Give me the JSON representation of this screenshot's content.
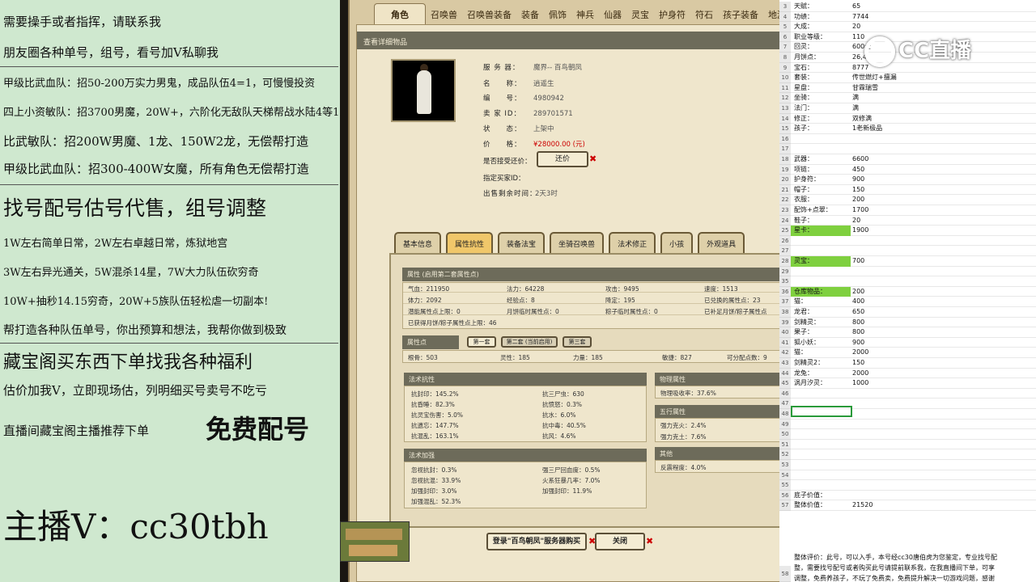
{
  "left_panel": {
    "lines": [
      "需要操手或者指挥，请联系我",
      "朋友圈各种单号，组号，看号加V私聊我",
      "甲级比武血队：招50-200万实力男鬼，成品队伍4=1，可慢慢投资",
      "四上小资敏队：招3700男魔，20W+，六阶化无敌队天梯帮战水陆4等1",
      "比武敏队：招200W男魔、1龙、150W2龙，无偿帮打造",
      "甲级比武血队：招300-400W女魔，所有角色无偿帮打造",
      "找号配号估号代售，组号调整",
      "1W左右简单日常，2W左右卓越日常，炼狱地宫",
      "3W左右异光通关，5W混杀14星，7W大力队伍砍穷奇",
      "10W+抽秒14.15穷奇，20W+5族队伍轻松虐一切副本!",
      "帮打造各种队伍单号，你出预算和想法，我帮你做到极致",
      "藏宝阁买东西下单找我各种福利",
      "估价加我V，立即现场估，列明细买号卖号不吃亏",
      "直播间藏宝阁主播推荐下单",
      "免费配号",
      "主播V：cc30tbh"
    ]
  },
  "game": {
    "tabs": [
      "角色",
      "召唤兽",
      "召唤兽装备",
      "装备",
      "佩饰",
      "神兵",
      "仙器",
      "灵宝",
      "护身符",
      "符石",
      "孩子装备",
      "地游星"
    ],
    "panel_title": "查看详细物品",
    "info": [
      {
        "k": "服 务 器：",
        "v": "魔界-- 百鸟朝凤"
      },
      {
        "k": "名　　称：",
        "v": "逍遥生"
      },
      {
        "k": "编　　号：",
        "v": "4980942"
      },
      {
        "k": "卖 家 ID：",
        "v": "289701571"
      },
      {
        "k": "状　　态：",
        "v": "上架中"
      },
      {
        "k": "价　　格：",
        "v": "¥28000.00 (元)"
      }
    ],
    "counter_offer_label": "是否接受还价：",
    "counter_offer_button": "还价",
    "buyer_id_label": "指定买家ID：",
    "remaining_label": "出售剩余时间：",
    "remaining_value": "2天3时",
    "subtabs": [
      "基本信息",
      "属性抗性",
      "装备法宝",
      "坐骑召唤兽",
      "法术修正",
      "小孩",
      "外观道具"
    ],
    "attr_header": "属性 (启用第二套属性点)",
    "attr_rows": [
      [
        "气血：211950",
        "法力：64228",
        "攻击：9495",
        "速度：1513"
      ],
      [
        "体力：2092",
        "经验点：8",
        "降定：195",
        "已兑换的属性点：23"
      ],
      [
        "潜能属性点上限：0",
        "月饼临时属性点：0",
        "粽子临时属性点：0",
        "已补足月饼/粽子属性点"
      ],
      [
        "已获得月饼/粽子属性点上限：46",
        "",
        "",
        ""
      ]
    ],
    "attr_points_header": "属性点",
    "attr_sets": [
      "第一套",
      "第二套 (当前启用)",
      "第三套"
    ],
    "attr_points_row": [
      "根骨：503",
      "灵性：185",
      "力量：185",
      "敏捷：827",
      "可分配点数：9"
    ],
    "magic_resist_header": "法术抗性",
    "magic_resist": [
      [
        "抗封印：145.2%",
        "抗三尸虫：630"
      ],
      [
        "抗昏睡：82.3%",
        "抗愤怒：0.3%"
      ],
      [
        "抗灵宝伤害：5.0%",
        "抗水：6.0%"
      ],
      [
        "抗遗忘：147.7%",
        "抗中毒：40.5%"
      ],
      [
        "抗混乱：163.1%",
        "抗风：4.6%"
      ]
    ],
    "physical_header": "物理属性",
    "physical": "物理吸收率：37.6%",
    "five_elements_header": "五行属性",
    "five_elements": [
      "强力克火：2.4%",
      "强力克土：7.6%"
    ],
    "magic_boost_header": "法术加强",
    "magic_boost": [
      [
        "忽视抗封：0.3%",
        "强三尸回血度：0.5%"
      ],
      [
        "忽视抗混：33.9%",
        "火系狂暴几率：7.0%"
      ],
      [
        "加强封印：3.0%",
        "加强封印：11.9%"
      ],
      [
        "加强混乱：52.3%",
        ""
      ]
    ],
    "other_header": "其他",
    "other": "反震程度：4.0%",
    "buy_button": "登录\"百鸟朝凤\"服务器购买",
    "close_button": "关闭"
  },
  "sheet": {
    "rows": [
      {
        "n": "3",
        "a": "天赋：",
        "b": "65"
      },
      {
        "n": "4",
        "a": "功绩：",
        "b": "7744"
      },
      {
        "n": "5",
        "a": "大成：",
        "b": "20"
      },
      {
        "n": "6",
        "a": "职业等级：",
        "b": "110"
      },
      {
        "n": "7",
        "a": "回灵：",
        "b": "600士"
      },
      {
        "n": "8",
        "a": "月饼点：",
        "b": "26,4"
      },
      {
        "n": "9",
        "a": "宝石：",
        "b": "8777"
      },
      {
        "n": "10",
        "a": "套装：",
        "b": "传世燃灯+擅漏"
      },
      {
        "n": "11",
        "a": "星盘：",
        "b": "甘霖瑞雪"
      },
      {
        "n": "12",
        "a": "坐骑：",
        "b": "满"
      },
      {
        "n": "13",
        "a": "法门：",
        "b": "满"
      },
      {
        "n": "14",
        "a": "修正：",
        "b": "双修满"
      },
      {
        "n": "15",
        "a": "孩子：",
        "b": "1老新极品"
      },
      {
        "n": "16",
        "a": "",
        "b": ""
      },
      {
        "n": "17",
        "a": "",
        "b": ""
      },
      {
        "n": "18",
        "a": "武器：",
        "b": "6600"
      },
      {
        "n": "19",
        "a": "项链：",
        "b": "450"
      },
      {
        "n": "20",
        "a": "护身符：",
        "b": "900"
      },
      {
        "n": "21",
        "a": "帽子：",
        "b": "150"
      },
      {
        "n": "22",
        "a": "衣服：",
        "b": "200"
      },
      {
        "n": "23",
        "a": "配饰+点翠：",
        "b": "1700"
      },
      {
        "n": "24",
        "a": "鞋子：",
        "b": "20"
      },
      {
        "n": "25",
        "a": "星卡：",
        "b": "1900",
        "hl": true
      },
      {
        "n": "26",
        "a": "",
        "b": ""
      },
      {
        "n": "27",
        "a": "",
        "b": ""
      },
      {
        "n": "28",
        "a": "灵宝：",
        "b": "700",
        "hl": true
      },
      {
        "n": "29",
        "a": "",
        "b": ""
      },
      {
        "n": "35",
        "a": "",
        "b": ""
      },
      {
        "n": "36",
        "a": "仓库物品：",
        "b": "200",
        "hl": true
      },
      {
        "n": "37",
        "a": "猫：",
        "b": "400"
      },
      {
        "n": "38",
        "a": "龙君：",
        "b": "650"
      },
      {
        "n": "39",
        "a": "剑精灵：",
        "b": "800"
      },
      {
        "n": "40",
        "a": "果子：",
        "b": "800"
      },
      {
        "n": "41",
        "a": "狐小妖：",
        "b": "900"
      },
      {
        "n": "42",
        "a": "猫：",
        "b": "2000"
      },
      {
        "n": "43",
        "a": "剑精灵2：",
        "b": "150"
      },
      {
        "n": "44",
        "a": "龙兔：",
        "b": "2000"
      },
      {
        "n": "45",
        "a": "涡月汐灵：",
        "b": "1000"
      },
      {
        "n": "46",
        "a": "",
        "b": ""
      },
      {
        "n": "47",
        "a": "",
        "b": ""
      },
      {
        "n": "48",
        "a": "",
        "b": ""
      },
      {
        "n": "49",
        "a": "",
        "b": ""
      },
      {
        "n": "50",
        "a": "",
        "b": ""
      },
      {
        "n": "51",
        "a": "",
        "b": ""
      },
      {
        "n": "52",
        "a": "",
        "b": ""
      },
      {
        "n": "53",
        "a": "",
        "b": ""
      },
      {
        "n": "54",
        "a": "",
        "b": ""
      },
      {
        "n": "55",
        "a": "",
        "b": ""
      },
      {
        "n": "56",
        "a": "底子价值：",
        "b": ""
      },
      {
        "n": "57",
        "a": "整体价值：",
        "b": "21520"
      }
    ],
    "eval_lines": [
      "整体评价：此号，可以入手，本号经cc30唐伯虎为您鉴定，专业找号配",
      "整，需要找号配号或者购买此号请提前联系我，在我直播间下单，可享",
      "调整，免费养孩子，不玩了免费卖，免费提升解决一切游戏问题，感谢"
    ],
    "eval_row_num": "58"
  },
  "logo": {
    "text": "CC直播"
  }
}
